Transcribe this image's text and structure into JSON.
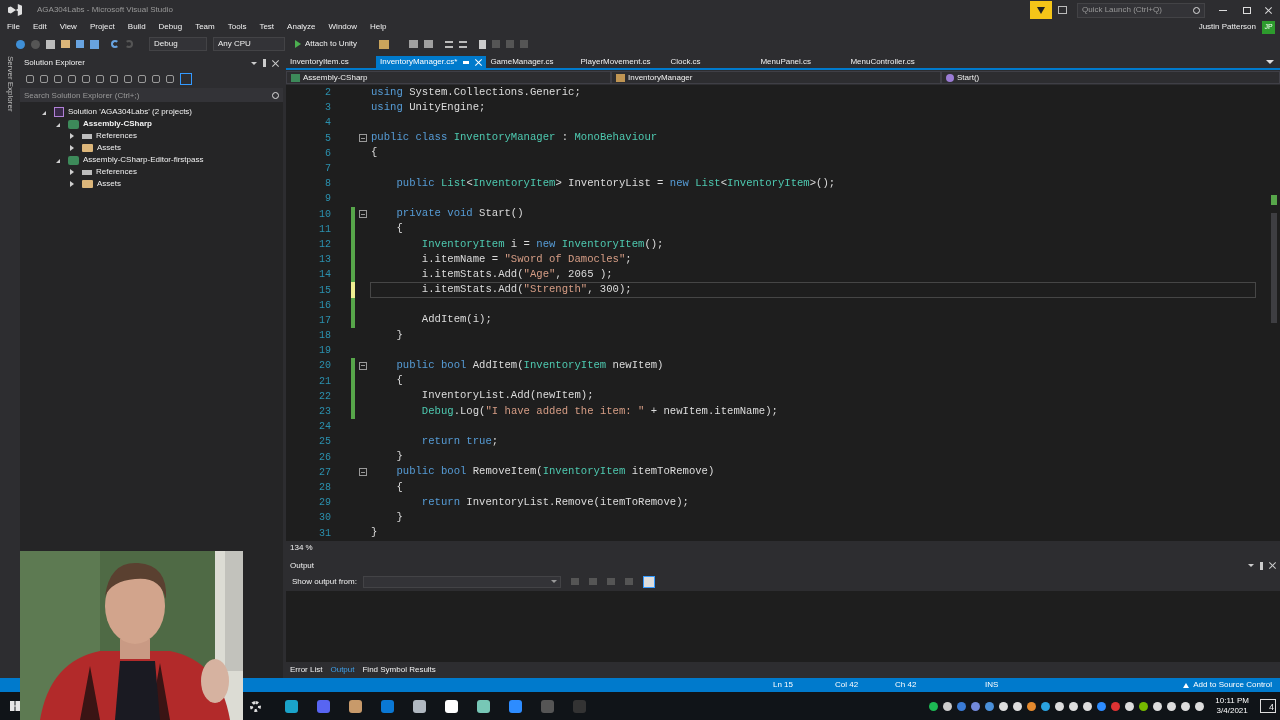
{
  "window": {
    "title": "AGA304Labs - Microsoft Visual Studio",
    "quick_launch": {
      "placeholder": "Quick Launch (Ctrl+Q)"
    },
    "user": {
      "name": "Justin Patterson",
      "initials": "JP"
    }
  },
  "menu": [
    "File",
    "Edit",
    "View",
    "Project",
    "Build",
    "Debug",
    "Team",
    "Tools",
    "Test",
    "Analyze",
    "Window",
    "Help"
  ],
  "toolbar": {
    "configuration": "Debug",
    "platform": "Any CPU",
    "run": "Attach to Unity"
  },
  "side_strip": {
    "label": "Server Explorer"
  },
  "solution_explorer": {
    "title": "Solution Explorer",
    "search": {
      "placeholder": "Search Solution Explorer (Ctrl+;)"
    },
    "tree": [
      {
        "label": "Solution 'AGA304Labs' (2 projects)",
        "kind": "solution",
        "bold": false,
        "expanded": true,
        "children": [
          {
            "label": "Assembly-CSharp",
            "kind": "project",
            "bold": true,
            "expanded": true,
            "children": [
              {
                "label": "References",
                "kind": "references",
                "bold": false,
                "expanded": false
              },
              {
                "label": "Assets",
                "kind": "folder",
                "bold": false,
                "expanded": false
              }
            ]
          },
          {
            "label": "Assembly-CSharp-Editor-firstpass",
            "kind": "project",
            "bold": false,
            "expanded": true,
            "children": [
              {
                "label": "References",
                "kind": "references",
                "bold": false,
                "expanded": false
              },
              {
                "label": "Assets",
                "kind": "folder",
                "bold": false,
                "expanded": false
              }
            ]
          }
        ]
      }
    ]
  },
  "editor": {
    "tabs": [
      {
        "label": "InventoryItem.cs",
        "selected": false
      },
      {
        "label": "InventoryManager.cs*",
        "selected": true
      },
      {
        "label": "GameManager.cs",
        "selected": false
      },
      {
        "label": "PlayerMovement.cs",
        "selected": false
      },
      {
        "label": "Clock.cs",
        "selected": false
      },
      {
        "label": "MenuPanel.cs",
        "selected": false
      },
      {
        "label": "MenuController.cs",
        "selected": false
      }
    ],
    "nav": {
      "project": "Assembly-CSharp",
      "class": "InventoryManager",
      "member": "Start()"
    },
    "lines": [
      {
        "number": "2",
        "collapsible": false,
        "modified": false,
        "unsaved": false,
        "current": false,
        "tokens": [
          {
            "text": "using",
            "kind": "keyword"
          },
          {
            "text": " System.Collections.Generic;",
            "kind": "plain"
          }
        ]
      },
      {
        "number": "3",
        "collapsible": false,
        "modified": false,
        "unsaved": false,
        "current": false,
        "tokens": [
          {
            "text": "using",
            "kind": "keyword"
          },
          {
            "text": " UnityEngine;",
            "kind": "plain"
          }
        ]
      },
      {
        "number": "4",
        "collapsible": false,
        "modified": false,
        "unsaved": false,
        "current": false
      },
      {
        "number": "5",
        "collapsible": true,
        "modified": false,
        "unsaved": false,
        "current": false,
        "tokens": [
          {
            "text": "public class",
            "kind": "keyword"
          },
          {
            "text": " InventoryManager",
            "kind": "type"
          },
          {
            "text": " : ",
            "kind": "plain"
          },
          {
            "text": "MonoBehaviour",
            "kind": "type"
          }
        ]
      },
      {
        "number": "6",
        "collapsible": false,
        "modified": false,
        "unsaved": false,
        "current": false,
        "tokens": [
          {
            "text": "{",
            "kind": "plain"
          }
        ]
      },
      {
        "number": "7",
        "collapsible": false,
        "modified": false,
        "unsaved": false,
        "current": false
      },
      {
        "number": "8",
        "collapsible": false,
        "modified": false,
        "unsaved": false,
        "current": false,
        "tokens": [
          {
            "text": "    public",
            "kind": "keyword"
          },
          {
            "text": " List",
            "kind": "type"
          },
          {
            "text": "<",
            "kind": "plain"
          },
          {
            "text": "InventoryItem",
            "kind": "type"
          },
          {
            "text": "> InventoryList = ",
            "kind": "plain"
          },
          {
            "text": "new",
            "kind": "keyword"
          },
          {
            "text": " List",
            "kind": "type"
          },
          {
            "text": "<",
            "kind": "plain"
          },
          {
            "text": "InventoryItem",
            "kind": "type"
          },
          {
            "text": ">();",
            "kind": "plain"
          }
        ]
      },
      {
        "number": "9",
        "collapsible": false,
        "modified": false,
        "unsaved": false,
        "current": false
      },
      {
        "number": "10",
        "collapsible": true,
        "modified": true,
        "unsaved": false,
        "current": false,
        "tokens": [
          {
            "text": "    private void",
            "kind": "keyword"
          },
          {
            "text": " Start()",
            "kind": "plain"
          }
        ]
      },
      {
        "number": "11",
        "collapsible": false,
        "modified": true,
        "unsaved": false,
        "current": false,
        "tokens": [
          {
            "text": "    {",
            "kind": "plain"
          }
        ]
      },
      {
        "number": "12",
        "collapsible": false,
        "modified": true,
        "unsaved": false,
        "current": false,
        "tokens": [
          {
            "text": "        InventoryItem",
            "kind": "type"
          },
          {
            "text": " i = ",
            "kind": "plain"
          },
          {
            "text": "new",
            "kind": "keyword"
          },
          {
            "text": " InventoryItem",
            "kind": "type"
          },
          {
            "text": "();",
            "kind": "plain"
          }
        ]
      },
      {
        "number": "13",
        "collapsible": false,
        "modified": true,
        "unsaved": false,
        "current": false,
        "tokens": [
          {
            "text": "        i.itemName = ",
            "kind": "plain"
          },
          {
            "text": "\"Sword of Damocles\"",
            "kind": "string"
          },
          {
            "text": ";",
            "kind": "plain"
          }
        ]
      },
      {
        "number": "14",
        "collapsible": false,
        "modified": true,
        "unsaved": false,
        "current": false,
        "tokens": [
          {
            "text": "        i.itemStats.Add(",
            "kind": "plain"
          },
          {
            "text": "\"Age\"",
            "kind": "string"
          },
          {
            "text": ", 2065 );",
            "kind": "plain"
          }
        ]
      },
      {
        "number": "15",
        "collapsible": false,
        "modified": false,
        "unsaved": true,
        "current": true,
        "tokens": [
          {
            "text": "        i.itemStats.Add(",
            "kind": "plain"
          },
          {
            "text": "\"Strength\"",
            "kind": "string"
          },
          {
            "text": ", 300);",
            "kind": "plain"
          }
        ]
      },
      {
        "number": "16",
        "collapsible": false,
        "modified": true,
        "unsaved": false,
        "current": false
      },
      {
        "number": "17",
        "collapsible": false,
        "modified": true,
        "unsaved": false,
        "current": false,
        "tokens": [
          {
            "text": "        AddItem(i);",
            "kind": "plain"
          }
        ]
      },
      {
        "number": "18",
        "collapsible": false,
        "modified": false,
        "unsaved": false,
        "current": false,
        "tokens": [
          {
            "text": "    }",
            "kind": "plain"
          }
        ]
      },
      {
        "number": "19",
        "collapsible": false,
        "modified": false,
        "unsaved": false,
        "current": false
      },
      {
        "number": "20",
        "collapsible": true,
        "modified": true,
        "unsaved": false,
        "current": false,
        "tokens": [
          {
            "text": "    public bool",
            "kind": "keyword"
          },
          {
            "text": " AddItem(",
            "kind": "plain"
          },
          {
            "text": "InventoryItem",
            "kind": "type"
          },
          {
            "text": " newItem)",
            "kind": "plain"
          }
        ]
      },
      {
        "number": "21",
        "collapsible": false,
        "modified": true,
        "unsaved": false,
        "current": false,
        "tokens": [
          {
            "text": "    {",
            "kind": "plain"
          }
        ]
      },
      {
        "number": "22",
        "collapsible": false,
        "modified": true,
        "unsaved": false,
        "current": false,
        "tokens": [
          {
            "text": "        InventoryList.Add(newItem);",
            "kind": "plain"
          }
        ]
      },
      {
        "number": "23",
        "collapsible": false,
        "modified": true,
        "unsaved": false,
        "current": false,
        "tokens": [
          {
            "text": "        Debug",
            "kind": "type"
          },
          {
            "text": ".Log(",
            "kind": "plain"
          },
          {
            "text": "\"I have added the item: \"",
            "kind": "string"
          },
          {
            "text": " + newItem.itemName);",
            "kind": "plain"
          }
        ]
      },
      {
        "number": "24",
        "collapsible": false,
        "modified": false,
        "unsaved": false,
        "current": false
      },
      {
        "number": "25",
        "collapsible": false,
        "modified": false,
        "unsaved": false,
        "current": false,
        "tokens": [
          {
            "text": "        return true",
            "kind": "keyword"
          },
          {
            "text": ";",
            "kind": "plain"
          }
        ]
      },
      {
        "number": "26",
        "collapsible": false,
        "modified": false,
        "unsaved": false,
        "current": false,
        "tokens": [
          {
            "text": "    }",
            "kind": "plain"
          }
        ]
      },
      {
        "number": "27",
        "collapsible": true,
        "modified": false,
        "unsaved": false,
        "current": false,
        "tokens": [
          {
            "text": "    public bool",
            "kind": "keyword"
          },
          {
            "text": " RemoveItem(",
            "kind": "plain"
          },
          {
            "text": "InventoryItem",
            "kind": "type"
          },
          {
            "text": " itemToRemove)",
            "kind": "plain"
          }
        ]
      },
      {
        "number": "28",
        "collapsible": false,
        "modified": false,
        "unsaved": false,
        "current": false,
        "tokens": [
          {
            "text": "    {",
            "kind": "plain"
          }
        ]
      },
      {
        "number": "29",
        "collapsible": false,
        "modified": false,
        "unsaved": false,
        "current": false,
        "tokens": [
          {
            "text": "        return",
            "kind": "keyword"
          },
          {
            "text": " InventoryList.Remove(itemToRemove);",
            "kind": "plain"
          }
        ]
      },
      {
        "number": "30",
        "collapsible": false,
        "modified": false,
        "unsaved": false,
        "current": false,
        "tokens": [
          {
            "text": "    }",
            "kind": "plain"
          }
        ]
      },
      {
        "number": "31",
        "collapsible": false,
        "modified": false,
        "unsaved": false,
        "current": false,
        "tokens": [
          {
            "text": "}",
            "kind": "plain"
          }
        ]
      }
    ],
    "zoom": "134 %"
  },
  "output": {
    "title": "Output",
    "source_label": "Show output from:"
  },
  "bottom_tabs": [
    {
      "label": "Error List",
      "selected": false
    },
    {
      "label": "Output",
      "selected": true
    },
    {
      "label": "Find Symbol Results",
      "selected": false
    }
  ],
  "status_bar": {
    "line": "Ln 15",
    "column": "Col 42",
    "char": "Ch 42",
    "mode": "INS",
    "source_control": "Add to Source Control"
  },
  "taskbar": {
    "time": "10:11 PM",
    "date": "3/4/2021",
    "notifications": "4"
  }
}
